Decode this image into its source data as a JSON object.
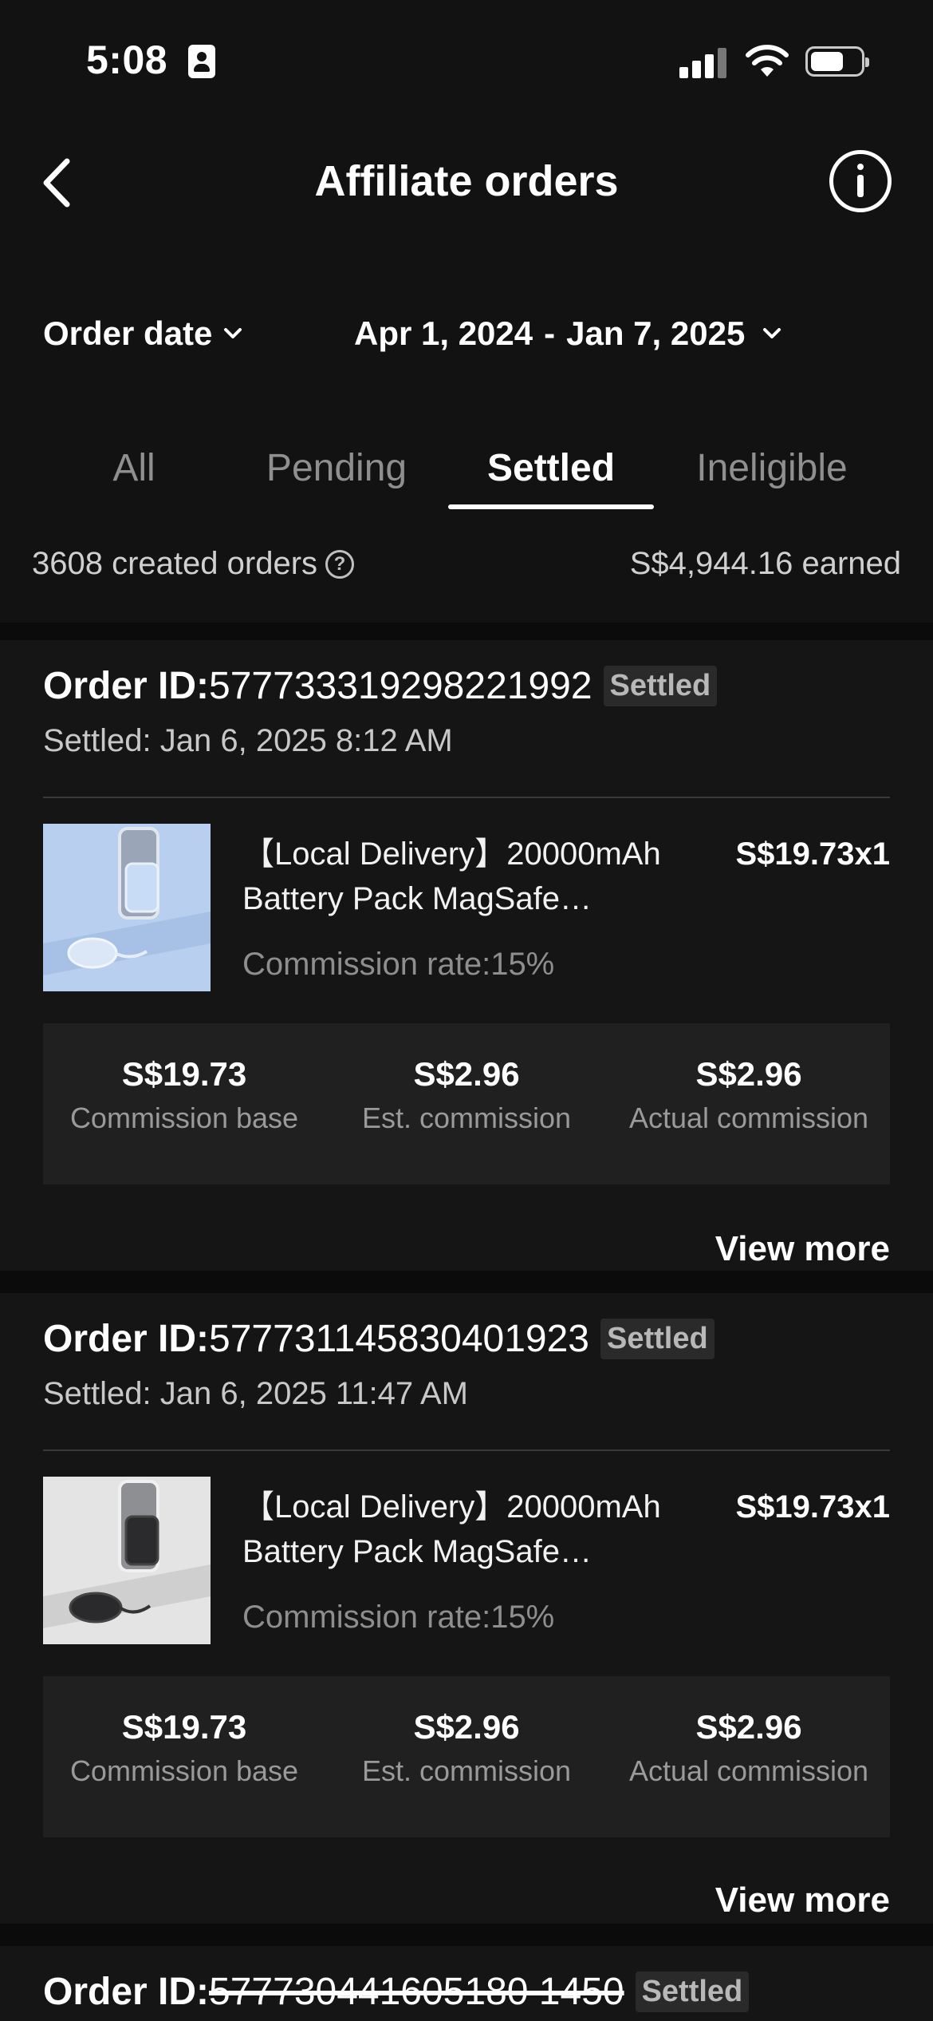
{
  "status_bar": {
    "time": "5:08"
  },
  "header": {
    "title": "Affiliate orders"
  },
  "filters": {
    "date_label": "Order date",
    "range_start": "Apr 1, 2024",
    "range_sep": "-",
    "range_end": "Jan 7, 2025"
  },
  "tabs": [
    {
      "label": "All",
      "active": false
    },
    {
      "label": "Pending",
      "active": false
    },
    {
      "label": "Settled",
      "active": true
    },
    {
      "label": "Ineligible",
      "active": false
    }
  ],
  "summary": {
    "created_orders": "3608 created orders",
    "earned": "S$4,944.16 earned"
  },
  "orders": [
    {
      "order_label": "Order ID:",
      "order_id": "577733319298221992",
      "status": "Settled",
      "settled_time": "Settled: Jan 6, 2025 8:12 AM",
      "product_name": "【Local Delivery】20000mAh Battery Pack MagSafe…",
      "price": "S$19.73x1",
      "commission_rate": "Commission rate:15%",
      "stats": [
        {
          "value": "S$19.73",
          "label": "Commission base"
        },
        {
          "value": "S$2.96",
          "label": "Est. commission"
        },
        {
          "value": "S$2.96",
          "label": "Actual commission"
        }
      ],
      "view_more": "View more",
      "thumb_theme": "blue"
    },
    {
      "order_label": "Order ID:",
      "order_id": "577731145830401923",
      "status": "Settled",
      "settled_time": "Settled: Jan 6, 2025 11:47 AM",
      "product_name": "【Local Delivery】20000mAh Battery Pack MagSafe…",
      "price": "S$19.73x1",
      "commission_rate": "Commission rate:15%",
      "stats": [
        {
          "value": "S$19.73",
          "label": "Commission base"
        },
        {
          "value": "S$2.96",
          "label": "Est. commission"
        },
        {
          "value": "S$2.96",
          "label": "Actual commission"
        }
      ],
      "view_more": "View more",
      "thumb_theme": "black"
    },
    {
      "order_label": "Order ID:",
      "order_id": "577730441605180 1450",
      "status": "Settled"
    }
  ]
}
